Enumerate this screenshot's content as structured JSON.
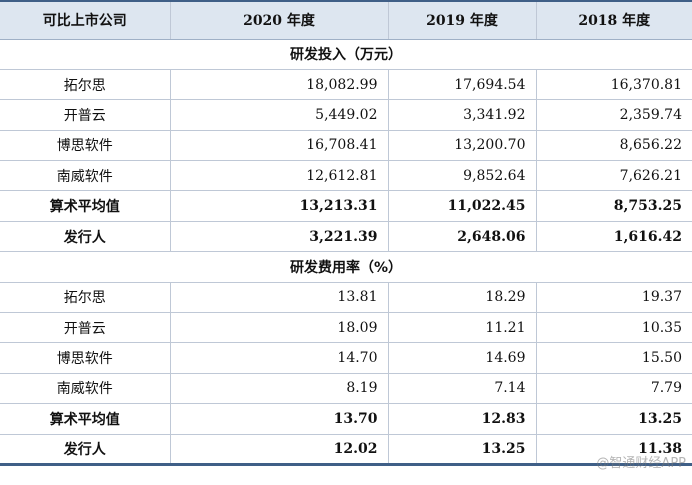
{
  "header": {
    "col0": "可比上市公司",
    "col1": "2020 年度",
    "col2": "2019 年度",
    "col3": "2018 年度"
  },
  "sections": [
    {
      "title": "研发投入（万元）",
      "rows": [
        {
          "name": "拓尔思",
          "v2020": "18,082.99",
          "v2019": "17,694.54",
          "v2018": "16,370.81",
          "bold": false
        },
        {
          "name": "开普云",
          "v2020": "5,449.02",
          "v2019": "3,341.92",
          "v2018": "2,359.74",
          "bold": false
        },
        {
          "name": "博思软件",
          "v2020": "16,708.41",
          "v2019": "13,200.70",
          "v2018": "8,656.22",
          "bold": false
        },
        {
          "name": "南威软件",
          "v2020": "12,612.81",
          "v2019": "9,852.64",
          "v2018": "7,626.21",
          "bold": false
        },
        {
          "name": "算术平均值",
          "v2020": "13,213.31",
          "v2019": "11,022.45",
          "v2018": "8,753.25",
          "bold": true
        },
        {
          "name": "发行人",
          "v2020": "3,221.39",
          "v2019": "2,648.06",
          "v2018": "1,616.42",
          "bold": true
        }
      ]
    },
    {
      "title": "研发费用率（%）",
      "rows": [
        {
          "name": "拓尔思",
          "v2020": "13.81",
          "v2019": "18.29",
          "v2018": "19.37",
          "bold": false
        },
        {
          "name": "开普云",
          "v2020": "18.09",
          "v2019": "11.21",
          "v2018": "10.35",
          "bold": false
        },
        {
          "name": "博思软件",
          "v2020": "14.70",
          "v2019": "14.69",
          "v2018": "15.50",
          "bold": false
        },
        {
          "name": "南威软件",
          "v2020": "8.19",
          "v2019": "7.14",
          "v2018": "7.79",
          "bold": false
        },
        {
          "name": "算术平均值",
          "v2020": "13.70",
          "v2019": "12.83",
          "v2018": "13.25",
          "bold": true
        },
        {
          "name": "发行人",
          "v2020": "12.02",
          "v2019": "13.25",
          "v2018": "11.38",
          "bold": true
        }
      ]
    }
  ],
  "watermark": "@智通财经APP"
}
